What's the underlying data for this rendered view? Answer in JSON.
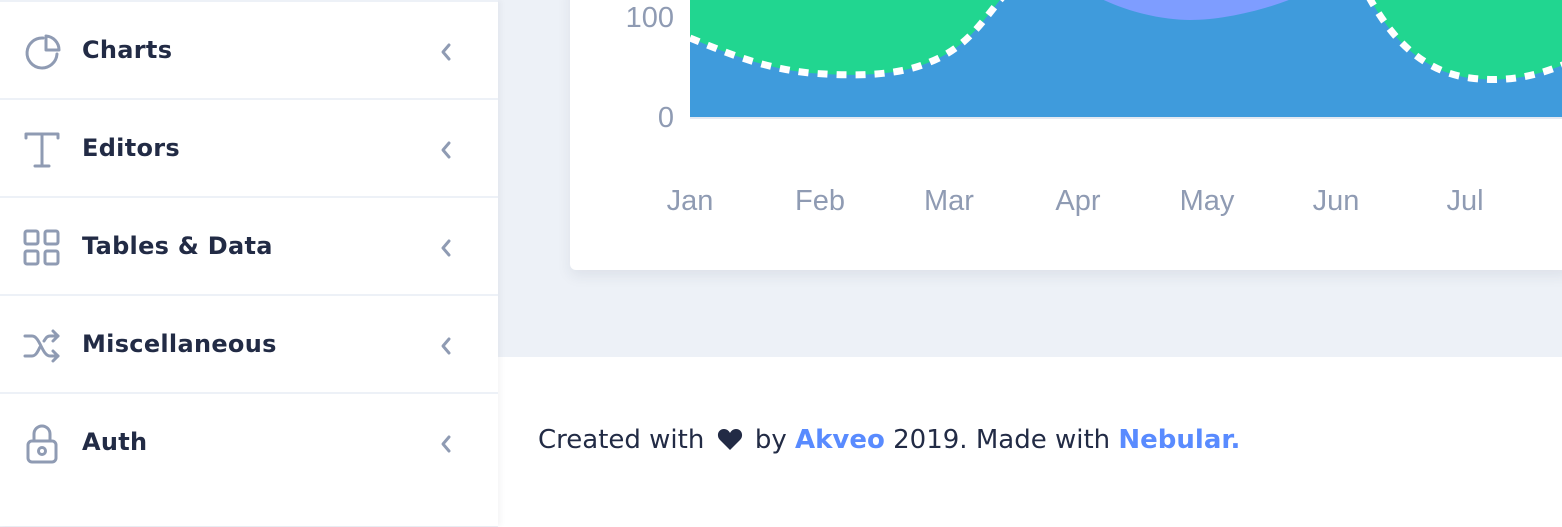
{
  "sidebar": {
    "items": [
      {
        "label": "Charts",
        "icon": "pie-chart-icon"
      },
      {
        "label": "Editors",
        "icon": "text-icon"
      },
      {
        "label": "Tables & Data",
        "icon": "grid-icon"
      },
      {
        "label": "Miscellaneous",
        "icon": "shuffle-icon"
      },
      {
        "label": "Auth",
        "icon": "lock-icon"
      }
    ]
  },
  "chart_data": {
    "type": "area",
    "categories": [
      "Jan",
      "Feb",
      "Mar",
      "Apr",
      "May",
      "Jun",
      "Jul"
    ],
    "yticks": [
      "100",
      "0"
    ],
    "colors": [
      "#3f9bdc",
      "#21d690",
      "#7e9dff"
    ]
  },
  "footer": {
    "prefix": "Created with",
    "by": "by",
    "company": "Akveo",
    "middle": "2019. Made with",
    "framework": "Nebular."
  },
  "colors": {
    "accent": "#598bff",
    "text": "#222b45",
    "hint": "#8f9bb3"
  }
}
